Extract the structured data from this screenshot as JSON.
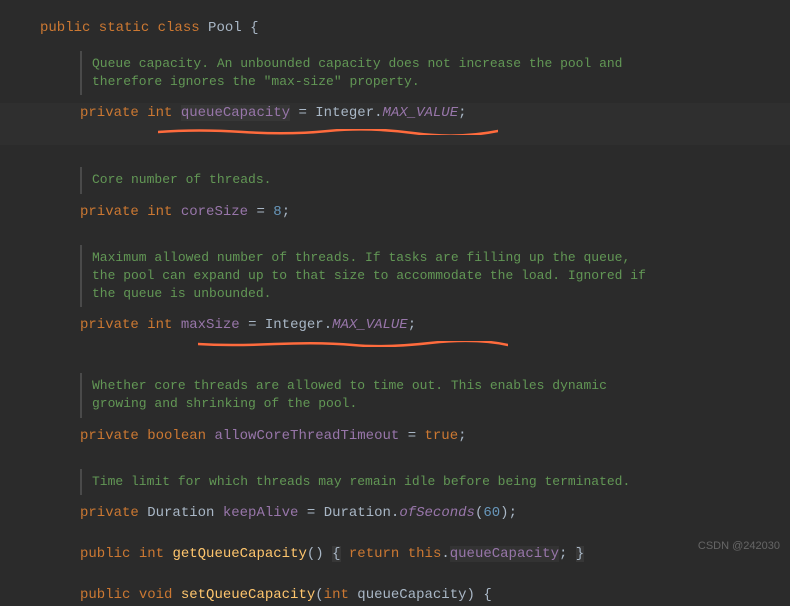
{
  "class_decl": {
    "modifiers": "public static class",
    "name": "Pool",
    "open": "{"
  },
  "fields": [
    {
      "doc": "Queue capacity. An unbounded capacity does not increase the pool and therefore ignores the \"max-size\" property.",
      "modifier": "private",
      "type": "int",
      "name": "queueCapacity",
      "assign": "=",
      "value_owner": "Integer",
      "value_dot": ".",
      "value_const": "MAX_VALUE",
      "semi": ";"
    },
    {
      "doc": "Core number of threads.",
      "modifier": "private",
      "type": "int",
      "name": "coreSize",
      "assign": "=",
      "value_num": "8",
      "semi": ";"
    },
    {
      "doc": "Maximum allowed number of threads. If tasks are filling up the queue, the pool can expand up to that size to accommodate the load. Ignored if the queue is unbounded.",
      "modifier": "private",
      "type": "int",
      "name": "maxSize",
      "assign": "=",
      "value_owner": "Integer",
      "value_dot": ".",
      "value_const": "MAX_VALUE",
      "semi": ";"
    },
    {
      "doc": "Whether core threads are allowed to time out. This enables dynamic growing and shrinking of the pool.",
      "modifier": "private",
      "type": "boolean",
      "name": "allowCoreThreadTimeout",
      "assign": "=",
      "value_kw": "true",
      "semi": ";"
    },
    {
      "doc": "Time limit for which threads may remain idle before being terminated.",
      "modifier": "private",
      "type": "Duration",
      "name": "keepAlive",
      "assign": "=",
      "value_owner": "Duration",
      "value_dot": ".",
      "value_method": "ofSeconds",
      "value_paren_open": "(",
      "value_num": "60",
      "value_paren_close": ")",
      "semi": ";"
    }
  ],
  "methods": [
    {
      "modifier": "public",
      "ret": "int",
      "name": "getQueueCapacity",
      "params": "()",
      "body_open": "{",
      "body_return": "return",
      "body_this": "this",
      "body_dot": ".",
      "body_field": "queueCapacity",
      "body_semi": ";",
      "body_close": "}"
    },
    {
      "modifier": "public",
      "ret": "void",
      "name": "setQueueCapacity",
      "param_paren_open": "(",
      "param_type": "int",
      "param_name": "queueCapacity",
      "param_paren_close": ")",
      "body_open": "{"
    }
  ],
  "underline_color": "#ff6b3d",
  "watermark": "CSDN @242030"
}
